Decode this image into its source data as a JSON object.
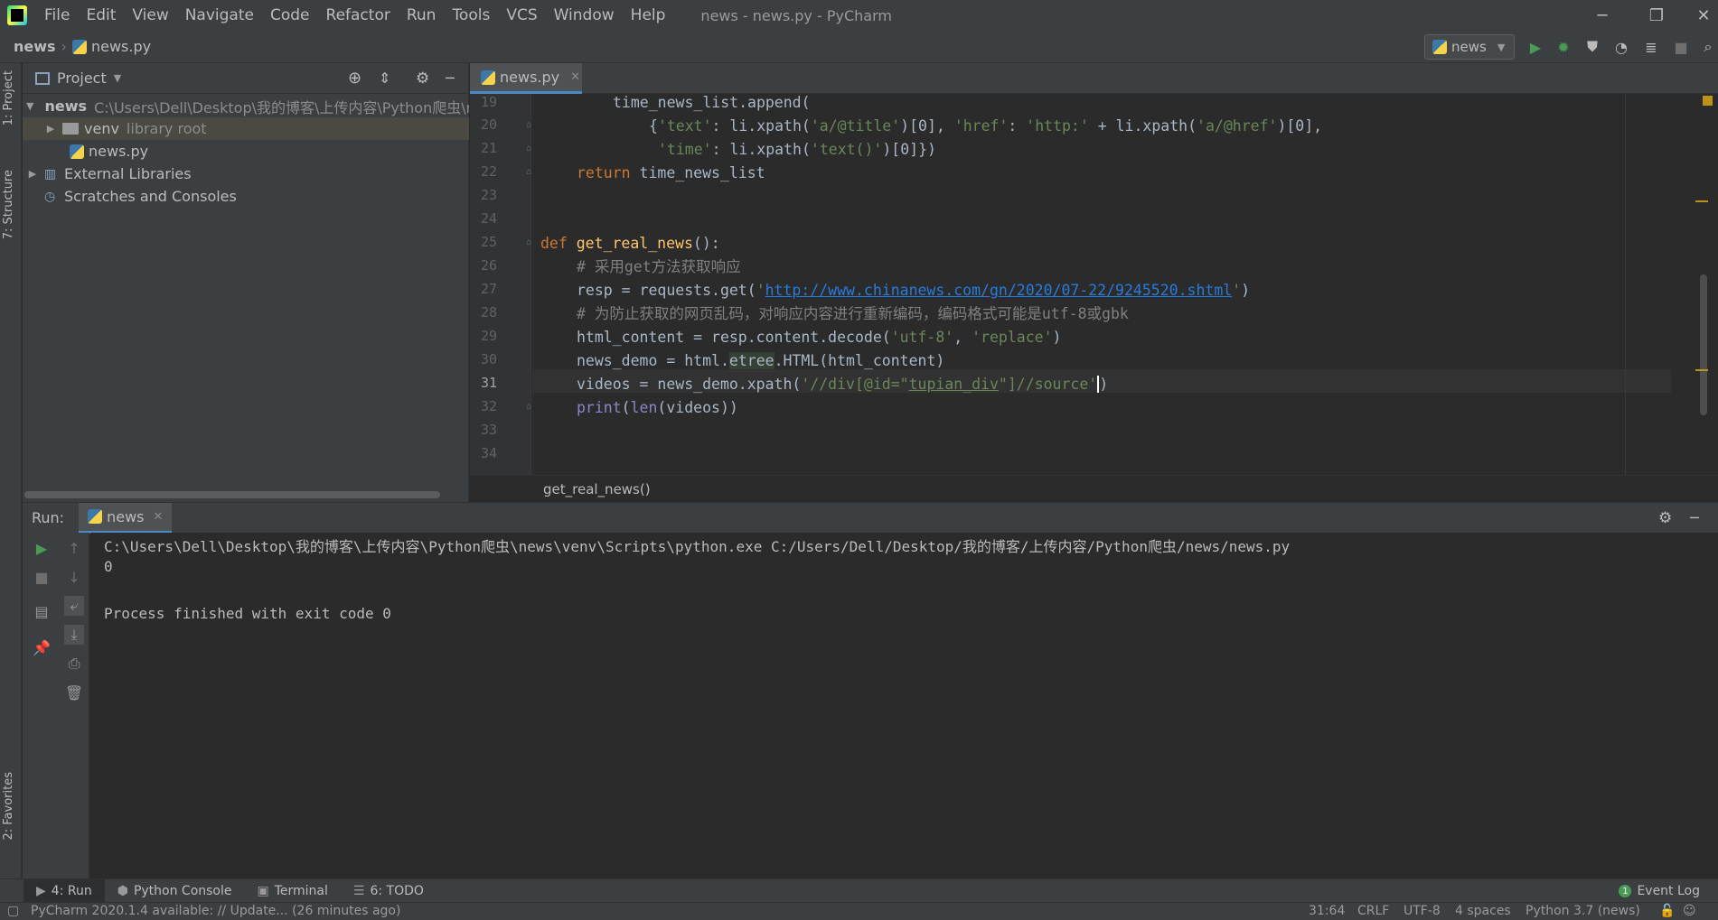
{
  "window": {
    "title": "news - news.py - PyCharm"
  },
  "menu": [
    "File",
    "Edit",
    "View",
    "Navigate",
    "Code",
    "Refactor",
    "Run",
    "Tools",
    "VCS",
    "Window",
    "Help"
  ],
  "navbar": {
    "project": "news",
    "file": "news.py",
    "run_config": "news"
  },
  "left_stripe": {
    "project_tab": "1: Project",
    "structure_tab": "7: Structure",
    "favorites_tab": "2: Favorites"
  },
  "project_panel": {
    "title": "Project",
    "tree": [
      {
        "name": "news",
        "detail": "C:\\Users\\Dell\\Desktop\\我的博客\\上传内容\\Python爬虫\\ne"
      },
      {
        "name": "venv",
        "detail": "library root"
      },
      {
        "name": "news.py",
        "detail": ""
      },
      {
        "name": "External Libraries",
        "detail": ""
      },
      {
        "name": "Scratches and Consoles",
        "detail": ""
      }
    ]
  },
  "editor": {
    "tab_label": "news.py",
    "line_numbers": [
      "19",
      "20",
      "21",
      "22",
      "23",
      "24",
      "25",
      "26",
      "27",
      "28",
      "29",
      "30",
      "31",
      "32",
      "33",
      "34"
    ],
    "code": {
      "l19": "time_news_list.append(",
      "l20_a": "{",
      "l20_s1": "'text'",
      "l20_b": ": li.xpath(",
      "l20_s2": "'a/@title'",
      "l20_c": ")[0], ",
      "l20_s3": "'href'",
      "l20_d": ": ",
      "l20_s4": "'http:'",
      "l20_e": " + li.xpath(",
      "l20_s5": "'a/@href'",
      "l20_f": ")[0],",
      "l21_s1": "'time'",
      "l21_a": ": li.xpath(",
      "l21_s2": "'text()'",
      "l21_b": ")[0]})",
      "l22_kw": "return",
      "l22_rest": " time_news_list",
      "l25_kw": "def",
      "l25_fn": "get_real_news",
      "l25_rest": "():",
      "l26_cmt": "# 采用get方法获取响应",
      "l27_a": "resp = requests.get(",
      "l27_q1": "'",
      "l27_url": "http://www.chinanews.com/gn/2020/07-22/9245520.shtml",
      "l27_q2": "'",
      "l27_b": ")",
      "l28_cmt": "# 为防止获取的网页乱码，对响应内容进行重新编码，编码格式可能是utf-8或gbk",
      "l29_a": "html_content = resp.content.decode(",
      "l29_s1": "'utf-8'",
      "l29_b": ", ",
      "l29_s2": "'replace'",
      "l29_c": ")",
      "l30_a": "news_demo = html.",
      "l30_hl": "etree",
      "l30_b": ".HTML(html_content)",
      "l31_a": "videos = news_demo.xpath(",
      "l31_s1": "'//div[@id=\"",
      "l31_typo": "tupian_div",
      "l31_s2": "\"]//source'",
      "l31_b": ")",
      "l32_bi1": "print",
      "l32_a": "(",
      "l32_bi2": "len",
      "l32_b": "(videos))"
    },
    "breadcrumb": "get_real_news()"
  },
  "run_panel": {
    "label": "Run:",
    "tab": "news",
    "output": [
      "C:\\Users\\Dell\\Desktop\\我的博客\\上传内容\\Python爬虫\\news\\venv\\Scripts\\python.exe C:/Users/Dell/Desktop/我的博客/上传内容/Python爬虫/news/news.py",
      "0",
      "",
      "Process finished with exit code 0"
    ]
  },
  "bottom_tabs": [
    {
      "label": "4: Run",
      "icon": "play-icon"
    },
    {
      "label": "Python Console",
      "icon": "python-icon"
    },
    {
      "label": "Terminal",
      "icon": "terminal-icon"
    },
    {
      "label": "6: TODO",
      "icon": "list-icon"
    }
  ],
  "event_log": {
    "count": "1",
    "label": "Event Log"
  },
  "status_bar": {
    "message": "PyCharm 2020.1.4 available: // Update... (26 minutes ago)",
    "position": "31:64",
    "line_sep": "CRLF",
    "encoding": "UTF-8",
    "indent": "4 spaces",
    "interpreter": "Python 3.7 (news)"
  },
  "colors": {
    "accent": "#4a88c7",
    "run_green": "#499c54",
    "keyword": "#cc7832",
    "string": "#6a8759"
  }
}
